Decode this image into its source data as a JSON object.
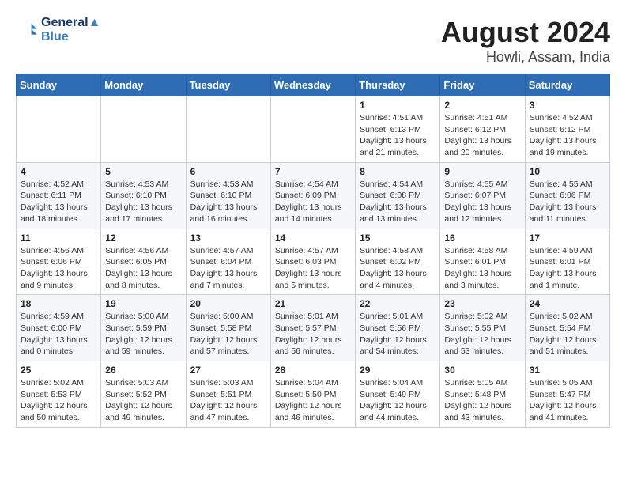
{
  "header": {
    "logo_line1": "General",
    "logo_line2": "Blue",
    "title": "August 2024",
    "subtitle": "Howli, Assam, India"
  },
  "weekdays": [
    "Sunday",
    "Monday",
    "Tuesday",
    "Wednesday",
    "Thursday",
    "Friday",
    "Saturday"
  ],
  "weeks": [
    [
      {
        "day": "",
        "detail": ""
      },
      {
        "day": "",
        "detail": ""
      },
      {
        "day": "",
        "detail": ""
      },
      {
        "day": "",
        "detail": ""
      },
      {
        "day": "1",
        "detail": "Sunrise: 4:51 AM\nSunset: 6:13 PM\nDaylight: 13 hours\nand 21 minutes."
      },
      {
        "day": "2",
        "detail": "Sunrise: 4:51 AM\nSunset: 6:12 PM\nDaylight: 13 hours\nand 20 minutes."
      },
      {
        "day": "3",
        "detail": "Sunrise: 4:52 AM\nSunset: 6:12 PM\nDaylight: 13 hours\nand 19 minutes."
      }
    ],
    [
      {
        "day": "4",
        "detail": "Sunrise: 4:52 AM\nSunset: 6:11 PM\nDaylight: 13 hours\nand 18 minutes."
      },
      {
        "day": "5",
        "detail": "Sunrise: 4:53 AM\nSunset: 6:10 PM\nDaylight: 13 hours\nand 17 minutes."
      },
      {
        "day": "6",
        "detail": "Sunrise: 4:53 AM\nSunset: 6:10 PM\nDaylight: 13 hours\nand 16 minutes."
      },
      {
        "day": "7",
        "detail": "Sunrise: 4:54 AM\nSunset: 6:09 PM\nDaylight: 13 hours\nand 14 minutes."
      },
      {
        "day": "8",
        "detail": "Sunrise: 4:54 AM\nSunset: 6:08 PM\nDaylight: 13 hours\nand 13 minutes."
      },
      {
        "day": "9",
        "detail": "Sunrise: 4:55 AM\nSunset: 6:07 PM\nDaylight: 13 hours\nand 12 minutes."
      },
      {
        "day": "10",
        "detail": "Sunrise: 4:55 AM\nSunset: 6:06 PM\nDaylight: 13 hours\nand 11 minutes."
      }
    ],
    [
      {
        "day": "11",
        "detail": "Sunrise: 4:56 AM\nSunset: 6:06 PM\nDaylight: 13 hours\nand 9 minutes."
      },
      {
        "day": "12",
        "detail": "Sunrise: 4:56 AM\nSunset: 6:05 PM\nDaylight: 13 hours\nand 8 minutes."
      },
      {
        "day": "13",
        "detail": "Sunrise: 4:57 AM\nSunset: 6:04 PM\nDaylight: 13 hours\nand 7 minutes."
      },
      {
        "day": "14",
        "detail": "Sunrise: 4:57 AM\nSunset: 6:03 PM\nDaylight: 13 hours\nand 5 minutes."
      },
      {
        "day": "15",
        "detail": "Sunrise: 4:58 AM\nSunset: 6:02 PM\nDaylight: 13 hours\nand 4 minutes."
      },
      {
        "day": "16",
        "detail": "Sunrise: 4:58 AM\nSunset: 6:01 PM\nDaylight: 13 hours\nand 3 minutes."
      },
      {
        "day": "17",
        "detail": "Sunrise: 4:59 AM\nSunset: 6:01 PM\nDaylight: 13 hours\nand 1 minute."
      }
    ],
    [
      {
        "day": "18",
        "detail": "Sunrise: 4:59 AM\nSunset: 6:00 PM\nDaylight: 13 hours\nand 0 minutes."
      },
      {
        "day": "19",
        "detail": "Sunrise: 5:00 AM\nSunset: 5:59 PM\nDaylight: 12 hours\nand 59 minutes."
      },
      {
        "day": "20",
        "detail": "Sunrise: 5:00 AM\nSunset: 5:58 PM\nDaylight: 12 hours\nand 57 minutes."
      },
      {
        "day": "21",
        "detail": "Sunrise: 5:01 AM\nSunset: 5:57 PM\nDaylight: 12 hours\nand 56 minutes."
      },
      {
        "day": "22",
        "detail": "Sunrise: 5:01 AM\nSunset: 5:56 PM\nDaylight: 12 hours\nand 54 minutes."
      },
      {
        "day": "23",
        "detail": "Sunrise: 5:02 AM\nSunset: 5:55 PM\nDaylight: 12 hours\nand 53 minutes."
      },
      {
        "day": "24",
        "detail": "Sunrise: 5:02 AM\nSunset: 5:54 PM\nDaylight: 12 hours\nand 51 minutes."
      }
    ],
    [
      {
        "day": "25",
        "detail": "Sunrise: 5:02 AM\nSunset: 5:53 PM\nDaylight: 12 hours\nand 50 minutes."
      },
      {
        "day": "26",
        "detail": "Sunrise: 5:03 AM\nSunset: 5:52 PM\nDaylight: 12 hours\nand 49 minutes."
      },
      {
        "day": "27",
        "detail": "Sunrise: 5:03 AM\nSunset: 5:51 PM\nDaylight: 12 hours\nand 47 minutes."
      },
      {
        "day": "28",
        "detail": "Sunrise: 5:04 AM\nSunset: 5:50 PM\nDaylight: 12 hours\nand 46 minutes."
      },
      {
        "day": "29",
        "detail": "Sunrise: 5:04 AM\nSunset: 5:49 PM\nDaylight: 12 hours\nand 44 minutes."
      },
      {
        "day": "30",
        "detail": "Sunrise: 5:05 AM\nSunset: 5:48 PM\nDaylight: 12 hours\nand 43 minutes."
      },
      {
        "day": "31",
        "detail": "Sunrise: 5:05 AM\nSunset: 5:47 PM\nDaylight: 12 hours\nand 41 minutes."
      }
    ]
  ]
}
